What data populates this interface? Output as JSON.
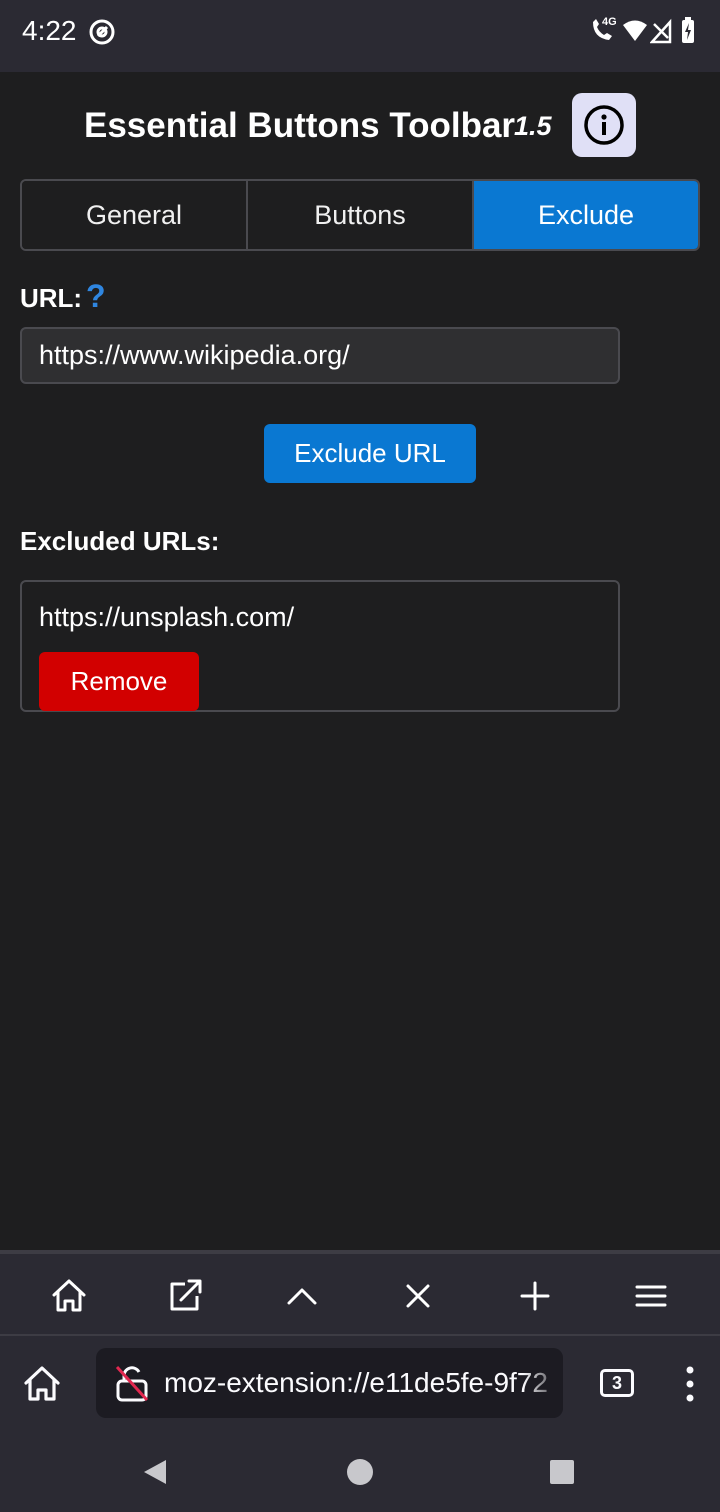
{
  "status_bar": {
    "time": "4:22",
    "network": "4G"
  },
  "header": {
    "title": "Essential Buttons Toolbar",
    "version": "1.5",
    "info_icon": "info-icon"
  },
  "tabs": [
    {
      "label": "General",
      "active": false
    },
    {
      "label": "Buttons",
      "active": false
    },
    {
      "label": "Exclude",
      "active": true
    }
  ],
  "url_section": {
    "label": "URL:",
    "help_glyph": "?",
    "input_value": "https://www.wikipedia.org/",
    "button_label": "Exclude URL"
  },
  "excluded_section": {
    "label": "Excluded URLs:",
    "items": [
      {
        "url": "https://unsplash.com/",
        "remove_label": "Remove"
      }
    ]
  },
  "extension_toolbar": {
    "icons": [
      "home-icon",
      "open-external-icon",
      "scroll-up-icon",
      "close-tab-icon",
      "new-tab-icon",
      "menu-icon"
    ]
  },
  "browser": {
    "address": "moz-extension://e11de5fe-9f72",
    "tab_count": "3"
  },
  "colors": {
    "accent": "#0a78d2",
    "danger": "#d20000",
    "background": "#1e1e1f"
  }
}
